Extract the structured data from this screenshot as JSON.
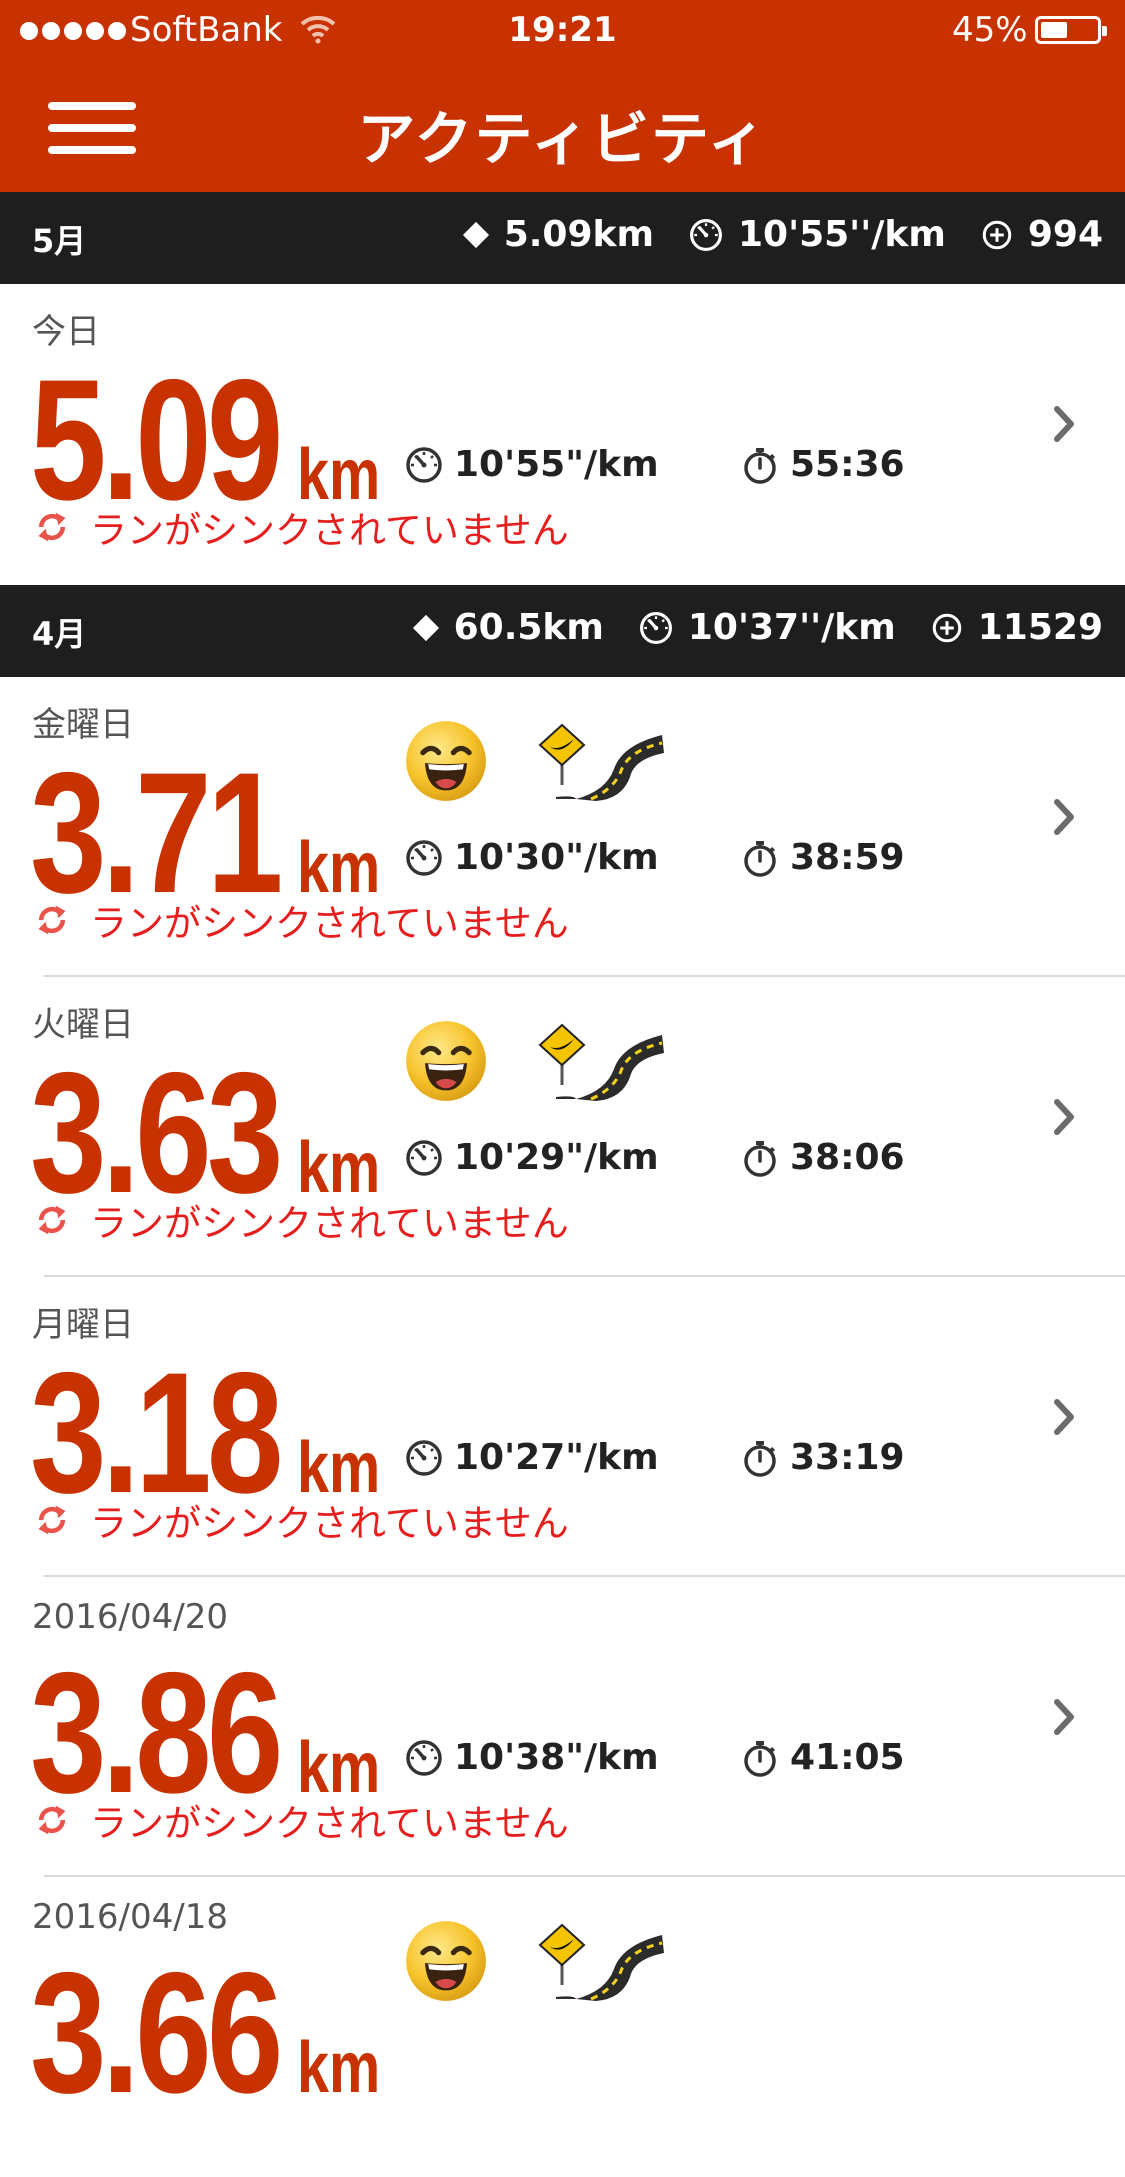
{
  "status_bar": {
    "carrier": "SoftBank",
    "time": "19:21",
    "battery": "45%",
    "battery_level": 0.45
  },
  "nav": {
    "title": "アクティビティ",
    "menu_icon": "hamburger-menu-icon"
  },
  "colors": {
    "brand": "#c83200",
    "header_dark": "#1e1e1e",
    "sync_warning": "#e61e1e"
  },
  "months": [
    {
      "label": "5月",
      "distance": "5.09km",
      "pace": "10'55''/km",
      "fuel": "994",
      "runs": [
        {
          "date": "今日",
          "distance": "5.09",
          "unit": "km",
          "pace": "10'55\"/km",
          "duration": "55:36",
          "sync": "ランがシンクされていません",
          "badges": []
        }
      ]
    },
    {
      "label": "4月",
      "distance": "60.5km",
      "pace": "10'37''/km",
      "fuel": "11529",
      "runs": [
        {
          "date": "金曜日",
          "distance": "3.71",
          "unit": "km",
          "pace": "10'30\"/km",
          "duration": "38:59",
          "sync": "ランがシンクされていません",
          "badges": [
            "smiley-icon",
            "road-badge-icon"
          ]
        },
        {
          "date": "火曜日",
          "distance": "3.63",
          "unit": "km",
          "pace": "10'29\"/km",
          "duration": "38:06",
          "sync": "ランがシンクされていません",
          "badges": [
            "smiley-icon",
            "road-badge-icon"
          ]
        },
        {
          "date": "月曜日",
          "distance": "3.18",
          "unit": "km",
          "pace": "10'27\"/km",
          "duration": "33:19",
          "sync": "ランがシンクされていません",
          "badges": []
        },
        {
          "date": "2016/04/20",
          "distance": "3.86",
          "unit": "km",
          "pace": "10'38\"/km",
          "duration": "41:05",
          "sync": "ランがシンクされていません",
          "badges": []
        },
        {
          "date": "2016/04/18",
          "distance": "3.66",
          "unit": "km",
          "pace": "",
          "duration": "",
          "sync": "",
          "badges": [
            "smiley-icon",
            "road-badge-icon"
          ]
        }
      ]
    }
  ]
}
